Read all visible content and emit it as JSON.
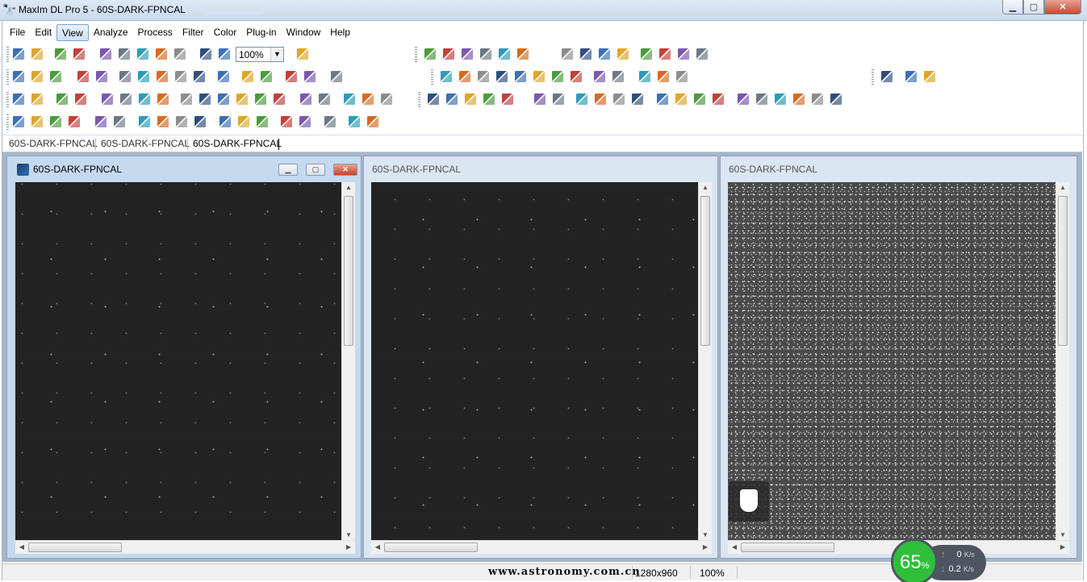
{
  "window": {
    "title": "MaxIm DL Pro 5 - 60S-DARK-FPNCAL",
    "minimize_glyph": "▁",
    "maximize_glyph": "▢",
    "close_glyph": "✕"
  },
  "menu": {
    "items": [
      {
        "label": "File"
      },
      {
        "label": "Edit"
      },
      {
        "label": "View",
        "active": true
      },
      {
        "label": "Analyze"
      },
      {
        "label": "Process"
      },
      {
        "label": "Filter"
      },
      {
        "label": "Color"
      },
      {
        "label": "Plug-in"
      },
      {
        "label": "Window"
      },
      {
        "label": "Help"
      }
    ]
  },
  "toolbar": {
    "zoom_value": "100%",
    "zoom_arrow": "▼"
  },
  "tabs": [
    {
      "label": "60S-DARK-FPNCAL"
    },
    {
      "label": "60S-DARK-FPNCAL"
    },
    {
      "label": "60S-DARK-FPNCAL",
      "active": true
    }
  ],
  "image_windows": [
    {
      "title": "60S-DARK-FPNCAL",
      "active": true
    },
    {
      "title": "60S-DARK-FPNCAL",
      "active": false
    },
    {
      "title": "60S-DARK-FPNCAL",
      "active": false
    }
  ],
  "window_controls": {
    "min": "▁",
    "restore": "▢",
    "close": "✕"
  },
  "scroll": {
    "up": "▲",
    "down": "▼",
    "left": "◀",
    "right": "▶"
  },
  "status": {
    "watermark": "www.astronomy.com.cn",
    "image_size": "1280x960",
    "zoom": "100%"
  },
  "network_widget": {
    "percent": "65",
    "percent_sign": "%",
    "upload": "0",
    "download": "0.2",
    "unit": "K/s",
    "up_arrow": "↑",
    "down_arrow": "↓"
  },
  "colors": {
    "title_bar": "#c9d9ec",
    "mdi_background": "#a6b6ca",
    "image_background": "#202020",
    "net_indicator": "#2fbf3b"
  }
}
